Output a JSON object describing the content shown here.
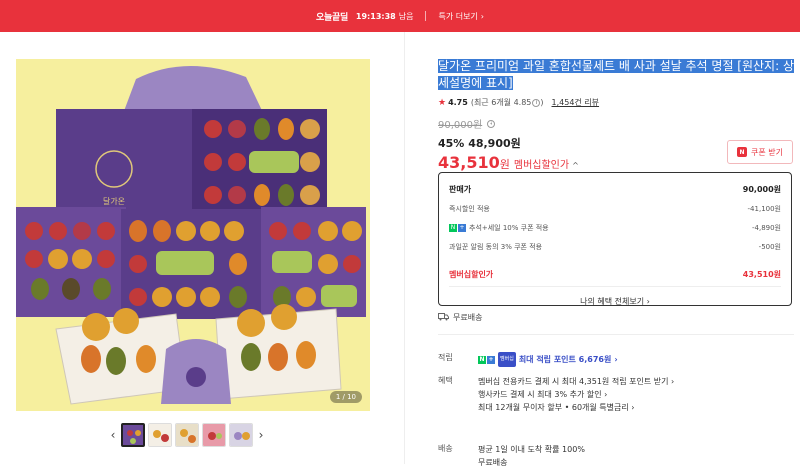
{
  "banner": {
    "deal_label": "오늘끝딜",
    "timer": "19:13:38",
    "timer_suffix": "남음",
    "more_label": "특가 더보기"
  },
  "gallery": {
    "counter": "1 / 10",
    "thumbnail_count": 5,
    "prev_icon": "chevron-left-icon",
    "next_icon": "chevron-right-icon",
    "box_brand": "달가온"
  },
  "product": {
    "title": "달가온 프리미엄 과일 혼합선물세트 배 사과 설날 추석 명절 [원산지: 상세설명에 표시]",
    "rating": "4.75",
    "rating_detail": "(최근 6개월 4.85",
    "rating_detail_close": ")",
    "review_label": "1,454건 리뷰",
    "original_price": "90,000원",
    "discount_rate": "45%",
    "discount_price": "48,900원",
    "member_price": "43,510",
    "member_price_won": "원",
    "member_price_label": "멤버십할인가",
    "coupon_label": "쿠폰 받기"
  },
  "price_breakdown": {
    "header_label": "판매가",
    "header_value": "90,000원",
    "rows": [
      {
        "label": "즉시할인 적용",
        "value": "-41,100원"
      },
      {
        "label": "추석+세일 10% 쿠폰 적용",
        "value": "-4,890원"
      },
      {
        "label": "과일꾼 알림 동의 3% 쿠폰 적용",
        "value": "-500원"
      }
    ],
    "total_label": "멤버십할인가",
    "total_value": "43,510원",
    "more_label": "나의 혜택 전체보기"
  },
  "shipping": {
    "label": "무료배송"
  },
  "points": {
    "key": "적립",
    "badge_label": "멤버십",
    "text": "최대 적립 포인트 6,676원"
  },
  "benefits": {
    "key": "혜택",
    "lines": [
      "멤버십 전용카드 결제 시 최대 4,351원 적립 포인트 받기",
      "행사카드 결제 시 최대 3% 추가 할인",
      "최대 12개월 무이자 할부 • 60개월 특별금리"
    ]
  },
  "delivery": {
    "key": "배송",
    "line1": "평균 1일 이내 도착 확률 100%",
    "line2": "무료배송"
  },
  "colors": {
    "accent": "#e8323c",
    "highlight": "#3a7bd5",
    "naver_green": "#03c75a"
  }
}
